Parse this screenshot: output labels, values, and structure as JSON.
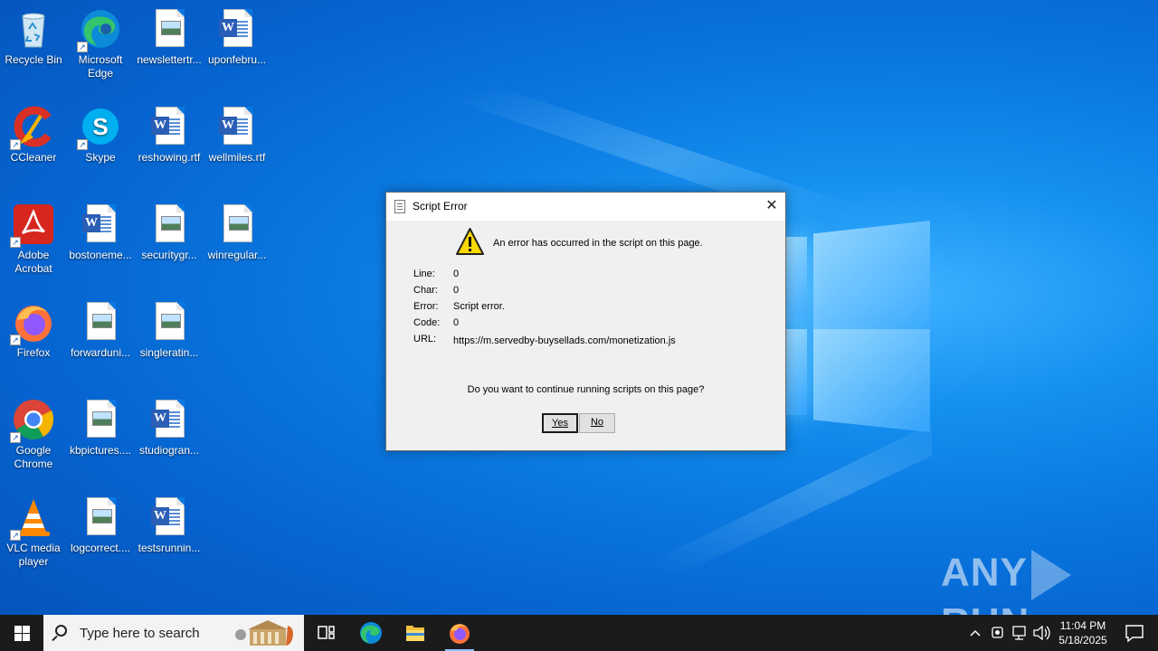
{
  "desktop": {
    "icons": [
      {
        "label": "Recycle Bin",
        "icon": "recycle-bin-icon"
      },
      {
        "label": "Microsoft Edge",
        "icon": "edge-icon"
      },
      {
        "label": "newslettertr...",
        "icon": "image-file-icon"
      },
      {
        "label": "uponfebru...",
        "icon": "word-document-icon"
      },
      {
        "label": "CCleaner",
        "icon": "ccleaner-icon"
      },
      {
        "label": "Skype",
        "icon": "skype-icon"
      },
      {
        "label": "reshowing.rtf",
        "icon": "word-document-icon"
      },
      {
        "label": "wellmiles.rtf",
        "icon": "word-document-icon"
      },
      {
        "label": "Adobe Acrobat",
        "icon": "acrobat-icon"
      },
      {
        "label": "bostoneme...",
        "icon": "word-document-icon"
      },
      {
        "label": "securitygr...",
        "icon": "image-file-icon"
      },
      {
        "label": "winregular...",
        "icon": "image-file-icon"
      },
      {
        "label": "Firefox",
        "icon": "firefox-icon"
      },
      {
        "label": "forwarduni...",
        "icon": "image-file-icon"
      },
      {
        "label": "singleratin...",
        "icon": "image-file-icon"
      },
      {
        "label": "Google Chrome",
        "icon": "chrome-icon"
      },
      {
        "label": "kbpictures....",
        "icon": "image-file-icon"
      },
      {
        "label": "studiogran...",
        "icon": "word-document-icon"
      },
      {
        "label": "VLC media player",
        "icon": "vlc-icon"
      },
      {
        "label": "logcorrect....",
        "icon": "image-file-icon"
      },
      {
        "label": "testsrunnin...",
        "icon": "word-document-icon"
      }
    ]
  },
  "dialog": {
    "title": "Script Error",
    "message": "An error has occurred in the script on this page.",
    "fields": [
      {
        "key": "Line:",
        "value": "0"
      },
      {
        "key": "Char:",
        "value": "0"
      },
      {
        "key": "Error:",
        "value": "Script error."
      },
      {
        "key": "Code:",
        "value": "0"
      },
      {
        "key": "URL:",
        "value": "https://m.servedby-buysellads.com/monetization.js"
      }
    ],
    "question": "Do you want to continue running scripts on this page?",
    "yes_label": "Yes",
    "no_label": "No"
  },
  "watermark": {
    "left": "ANY",
    "right": "RUN"
  },
  "taskbar": {
    "search_placeholder": "Type here to search",
    "time": "11:04 PM",
    "date": "5/18/2025"
  }
}
